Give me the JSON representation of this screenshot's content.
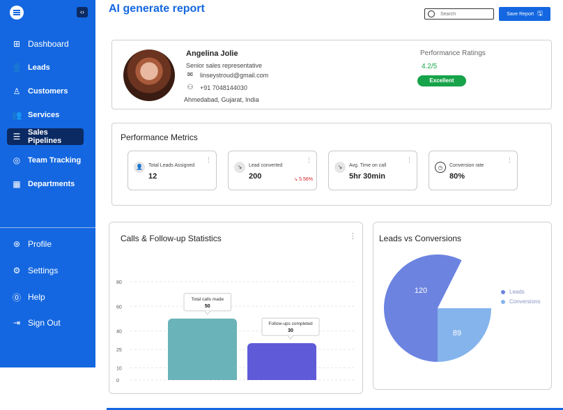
{
  "header": {
    "title": "AI generate report",
    "search_placeholder": "Search",
    "save_label": "Save Report"
  },
  "sidebar": {
    "collapse_glyph": "‹›",
    "items": [
      {
        "label": "Dashboard",
        "icon": "grid-icon"
      },
      {
        "label": "Leads",
        "icon": "users-icon"
      },
      {
        "label": "Customers",
        "icon": "user-star-icon"
      },
      {
        "label": "Services",
        "icon": "team-icon"
      },
      {
        "label": "Sales Pipelines",
        "icon": "checklist-icon"
      },
      {
        "label": "Team Tracking",
        "icon": "tracking-icon"
      },
      {
        "label": "Departments",
        "icon": "department-icon"
      }
    ],
    "bottom_items": [
      {
        "label": "Profile",
        "icon": "profile-icon"
      },
      {
        "label": "Settings",
        "icon": "gear-icon"
      },
      {
        "label": "Help",
        "icon": "help-icon"
      },
      {
        "label": "Sign Out",
        "icon": "sign-out-icon"
      }
    ],
    "active_item": "Sales Pipelines"
  },
  "profile": {
    "name": "Angelina Jolie",
    "role": "Senior sales representative",
    "email": "linseystroud@gmail.com",
    "phone": "+91 7048144030",
    "location": "Ahmedabad, Gujarat, India",
    "performance_title": "Performance Ratings",
    "performance_value": "4.2/5",
    "performance_badge": "Excellent"
  },
  "metrics": {
    "title": "Performance Metrics",
    "items": [
      {
        "label": "Total Leads Assigned",
        "value": "12",
        "trend": ""
      },
      {
        "label": "Lead converted",
        "value": "200",
        "trend": "5.56%"
      },
      {
        "label": "Avg. Time on call",
        "value": "5hr 30min",
        "trend": ""
      },
      {
        "label": "Conversion rate",
        "value": "80%",
        "trend": ""
      }
    ]
  },
  "calls_chart": {
    "title": "Calls & Follow-up Statistics"
  },
  "pie": {
    "title": "Leads vs Conversions"
  },
  "colors": {
    "brand": "#1467e0",
    "sidebar_active": "#0b2a63",
    "excellent": "#17a34a",
    "bar_calls": "#6ab3b8",
    "bar_followups": "#5f5ad8",
    "pie_leads": "#6c83e0",
    "pie_conversions": "#85b4ec"
  },
  "chart_data": [
    {
      "type": "bar",
      "title": "Calls & Follow-up Statistics",
      "categories": [
        "Total calls made",
        "Follow-ups completed"
      ],
      "values": [
        50,
        30
      ],
      "yticks": [
        0,
        10,
        25,
        40,
        60,
        80
      ],
      "ylim": [
        0,
        80
      ]
    },
    {
      "type": "pie",
      "title": "Leads vs Conversions",
      "labels": [
        "Leads",
        "Conversions"
      ],
      "values": [
        120,
        89
      ]
    }
  ]
}
